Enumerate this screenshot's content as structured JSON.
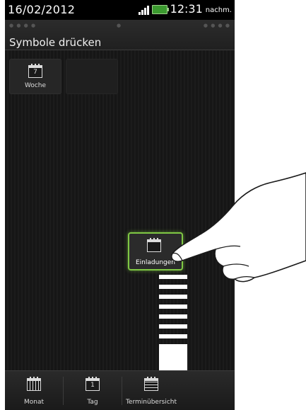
{
  "status": {
    "date": "16/02/2012",
    "time": "12:31",
    "ampm": "nachm."
  },
  "header": {
    "title": "Symbole drücken"
  },
  "slots": [
    {
      "label": "Woche",
      "number": "7"
    }
  ],
  "dragged": {
    "label": "Einladungen"
  },
  "bottom_tabs": [
    {
      "label": "Monat",
      "icon": "month-calendar-icon"
    },
    {
      "label": "Tag",
      "icon": "day-calendar-icon",
      "number": "1"
    },
    {
      "label": "Terminübersicht",
      "icon": "agenda-calendar-icon"
    }
  ],
  "colors": {
    "highlight": "#7fc844",
    "battery": "#3b9a2f",
    "background": "#141414"
  }
}
